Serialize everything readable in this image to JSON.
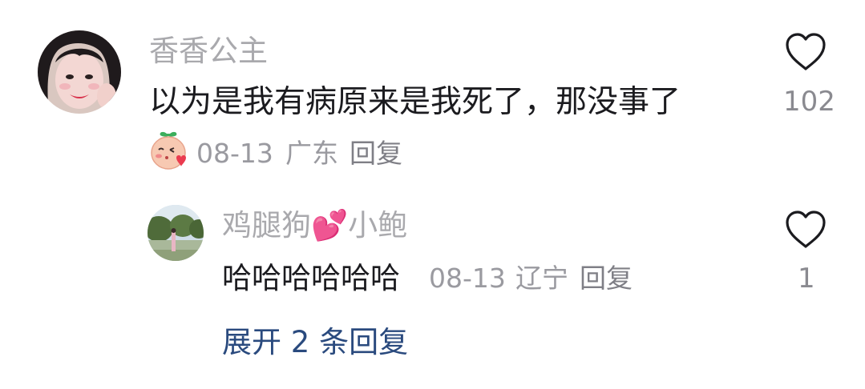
{
  "comment": {
    "username": "香香公主",
    "text": "以为是我有病原来是我死了，那没事了",
    "date": "08-13",
    "location": "广东",
    "reply_label": "回复",
    "like_count": "102",
    "avatar_icon": "user-avatar-photo",
    "badge_icon": "blushing-face-emoji"
  },
  "reply": {
    "username_part1": "鸡腿狗",
    "username_emoji": "💕",
    "username_part2": "小鲍",
    "text": "哈哈哈哈哈哈",
    "date": "08-13",
    "location": "辽宁",
    "reply_label": "回复",
    "like_count": "1",
    "avatar_icon": "user-avatar-photo"
  },
  "expand": {
    "label": "展开 2 条回复"
  },
  "colors": {
    "username": "#a9a9ad",
    "body": "#1b1b1f",
    "meta": "#9a9aa0",
    "link": "#2a4a7e",
    "heart_stroke": "#1b1b1f"
  }
}
